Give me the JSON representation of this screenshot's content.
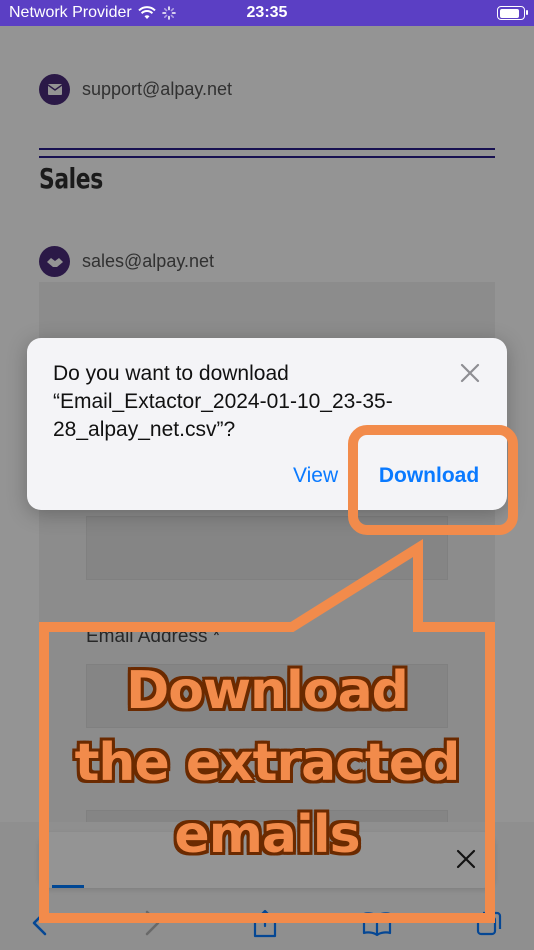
{
  "status_bar": {
    "carrier": "Network Provider",
    "time": "23:35",
    "battery_level": 0.9
  },
  "page": {
    "support_email": "support@alpay.net",
    "section_title": "Sales",
    "sales_email": "sales@alpay.net",
    "email_label": "Email Address *"
  },
  "dialog": {
    "message": "Do you want to download “Email_Extactor_2024-01-10_23-35-28_alpay_net.csv”?",
    "view_label": "View",
    "download_label": "Download"
  },
  "annotation": {
    "line1": "Download",
    "line2": "the extracted",
    "line3": "emails",
    "color": "#f28b4b"
  },
  "safari": {
    "load_progress": 0.07
  },
  "icons": [
    "wifi-icon",
    "loading-spinner-icon",
    "battery-icon",
    "mail-icon",
    "handshake-icon",
    "close-icon",
    "back-icon",
    "forward-icon",
    "share-icon",
    "bookmarks-icon",
    "tabs-icon"
  ]
}
